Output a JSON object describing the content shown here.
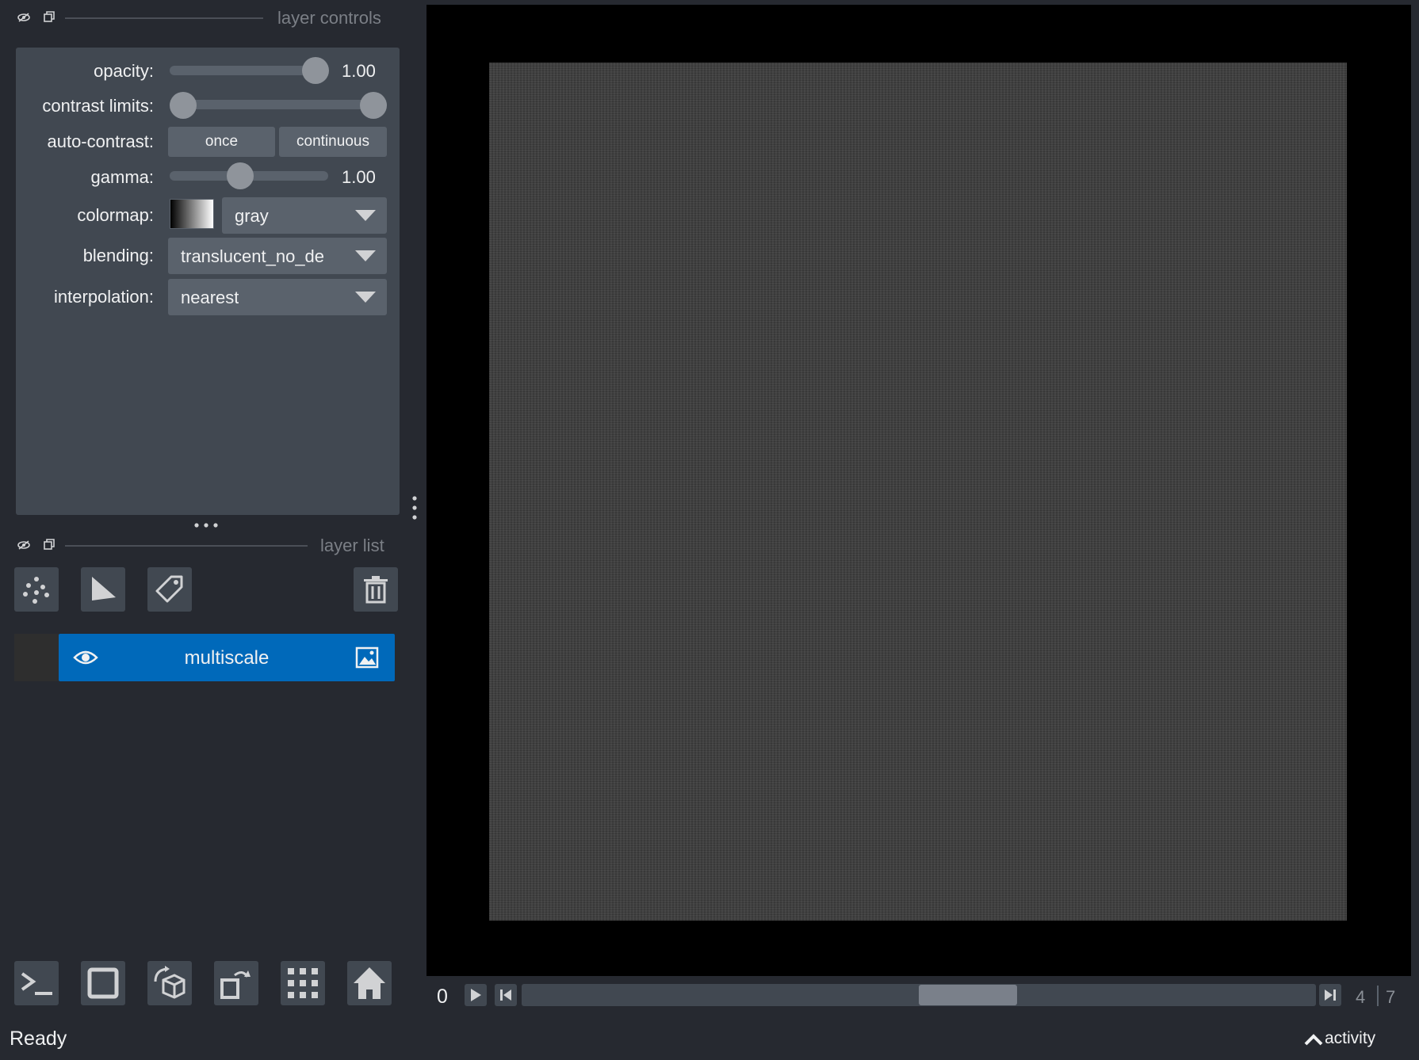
{
  "layer_controls": {
    "title": "layer controls",
    "opacity": {
      "label": "opacity:",
      "value": "1.00",
      "fraction": 1.0
    },
    "contrast_limits": {
      "label": "contrast limits:",
      "low_fraction": 0.0,
      "high_fraction": 1.0
    },
    "auto_contrast": {
      "label": "auto-contrast:",
      "once_label": "once",
      "continuous_label": "continuous"
    },
    "gamma": {
      "label": "gamma:",
      "value": "1.00",
      "fraction": 0.5
    },
    "colormap": {
      "label": "colormap:",
      "value": "gray"
    },
    "blending": {
      "label": "blending:",
      "value": "translucent_no_de"
    },
    "interpolation": {
      "label": "interpolation:",
      "value": "nearest"
    }
  },
  "layer_list": {
    "title": "layer list",
    "layers": [
      {
        "name": "multiscale",
        "visible": true,
        "type": "image"
      }
    ]
  },
  "viewer": {
    "dims": {
      "current_label": "0",
      "current_step": "4",
      "total_steps": "7"
    }
  },
  "status": {
    "text": "Ready",
    "activity_label": "activity"
  },
  "colors": {
    "accent": "#0069ba",
    "panel": "#414851",
    "background": "#262930"
  }
}
